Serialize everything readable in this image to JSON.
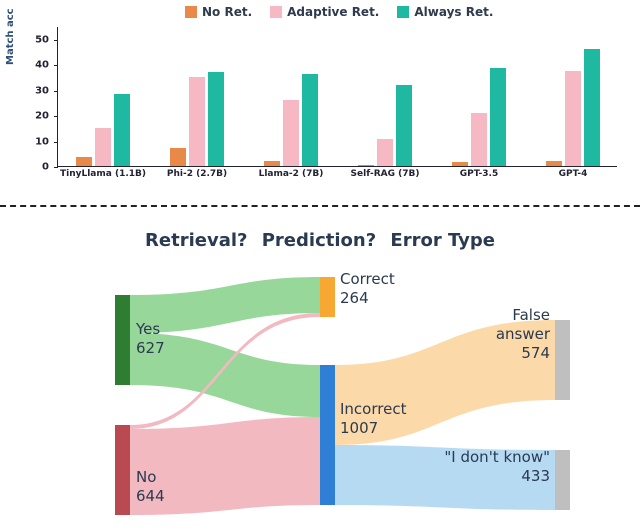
{
  "chart_data": [
    {
      "type": "bar",
      "title": "",
      "ylabel": "Match acc",
      "xlabel": "",
      "ylim": [
        0,
        55
      ],
      "yticks": [
        0,
        10,
        20,
        30,
        40,
        50
      ],
      "categories": [
        "TinyLlama (1.1B)",
        "Phi-2 (2.7B)",
        "Llama-2 (7B)",
        "Self-RAG (7B)",
        "GPT-3.5",
        "GPT-4"
      ],
      "series": [
        {
          "name": "No Ret.",
          "color": "#e8894a",
          "values": [
            3.5,
            7,
            2,
            0.5,
            1.5,
            2
          ]
        },
        {
          "name": "Adaptive Ret.",
          "color": "#f6b9c3",
          "values": [
            15,
            35,
            26,
            10.5,
            21,
            37.5
          ]
        },
        {
          "name": "Always Ret.",
          "color": "#1fb8a1",
          "values": [
            28.5,
            37,
            36,
            32,
            38.5,
            46
          ]
        }
      ],
      "legend_position": "top"
    },
    {
      "type": "sankey",
      "headers": [
        "Retrieval?",
        "Prediction?",
        "Error Type"
      ],
      "nodes": {
        "retrieval": [
          {
            "id": "yes",
            "label": "Yes",
            "value": 627,
            "color": "#2e7d32"
          },
          {
            "id": "no",
            "label": "No",
            "value": 644,
            "color": "#b94a52"
          }
        ],
        "prediction": [
          {
            "id": "correct",
            "label": "Correct",
            "value": 264,
            "color": "#f7a832"
          },
          {
            "id": "incorrect",
            "label": "Incorrect",
            "value": 1007,
            "color": "#2f7fd6"
          }
        ],
        "error_type": [
          {
            "id": "false_answer",
            "label": "False answer",
            "value": 574,
            "color": "#bfbfbf"
          },
          {
            "id": "idk",
            "label": "\"I don't know\"",
            "value": 433,
            "color": "#bfbfbf"
          }
        ]
      },
      "links": [
        {
          "from": "yes",
          "to": "correct",
          "color": "#97d79a"
        },
        {
          "from": "yes",
          "to": "incorrect",
          "color": "#97d79a"
        },
        {
          "from": "no",
          "to": "correct",
          "color": "#f3b9c1"
        },
        {
          "from": "no",
          "to": "incorrect",
          "color": "#f3b9c1"
        },
        {
          "from": "incorrect",
          "to": "false_answer",
          "color": "#fcd9a8"
        },
        {
          "from": "incorrect",
          "to": "idk",
          "color": "#b7daf3"
        }
      ]
    }
  ]
}
